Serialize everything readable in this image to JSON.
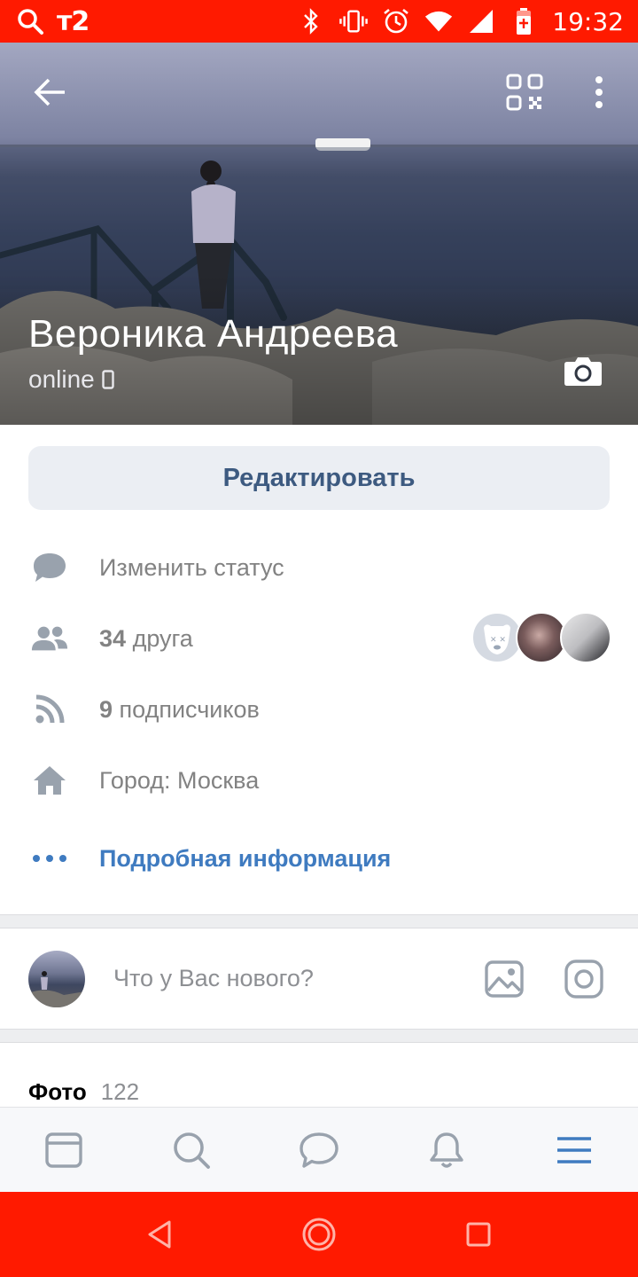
{
  "status_bar": {
    "carrier": "т2",
    "time": "19:32",
    "icons": [
      "search-icon",
      "bluetooth-icon",
      "vibrate-icon",
      "alarm-icon",
      "wifi-icon",
      "signal-icon",
      "battery-charging-icon"
    ]
  },
  "profile": {
    "name": "Вероника Андреева",
    "online_status": "online",
    "online_device_icon": "mobile-phone-icon",
    "edit_button_label": "Редактировать"
  },
  "info": {
    "status_label": "Изменить статус",
    "friends_count": "34",
    "friends_label": "друга",
    "followers_count": "9",
    "followers_label": "подписчиков",
    "city_label": "Город: Москва",
    "details_label": "Подробная информация"
  },
  "composer": {
    "placeholder": "Что у Вас нового?"
  },
  "photos": {
    "title": "Фото",
    "count": "122"
  },
  "bottom_nav": {
    "items": [
      "news-icon",
      "search-icon",
      "messages-icon",
      "notifications-icon",
      "menu-icon"
    ],
    "active": "menu-icon"
  },
  "colors": {
    "status_bar": "#ff1a00",
    "accent_link": "#3f7bc0",
    "edit_button_bg": "#ebeef3",
    "edit_button_text": "#3d5a80",
    "secondary_text": "#828282",
    "icon_gray": "#99a2ad"
  }
}
